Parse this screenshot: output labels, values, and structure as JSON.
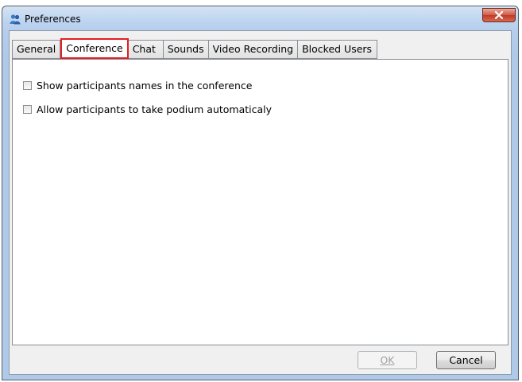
{
  "window": {
    "title": "Preferences"
  },
  "tabs": [
    {
      "label": "General",
      "active": false
    },
    {
      "label": "Conference",
      "active": true
    },
    {
      "label": "Chat",
      "active": false
    },
    {
      "label": "Sounds",
      "active": false
    },
    {
      "label": "Video Recording",
      "active": false
    },
    {
      "label": "Blocked Users",
      "active": false
    }
  ],
  "options": [
    {
      "label": "Show participants names in the conference",
      "checked": false
    },
    {
      "label": "Allow participants to take podium automaticaly",
      "checked": false
    }
  ],
  "buttons": {
    "ok_label": "OK",
    "ok_enabled": false,
    "cancel_label": "Cancel",
    "cancel_enabled": true
  },
  "colors": {
    "highlight": "#e31f24",
    "close_button": "#c03a28"
  }
}
